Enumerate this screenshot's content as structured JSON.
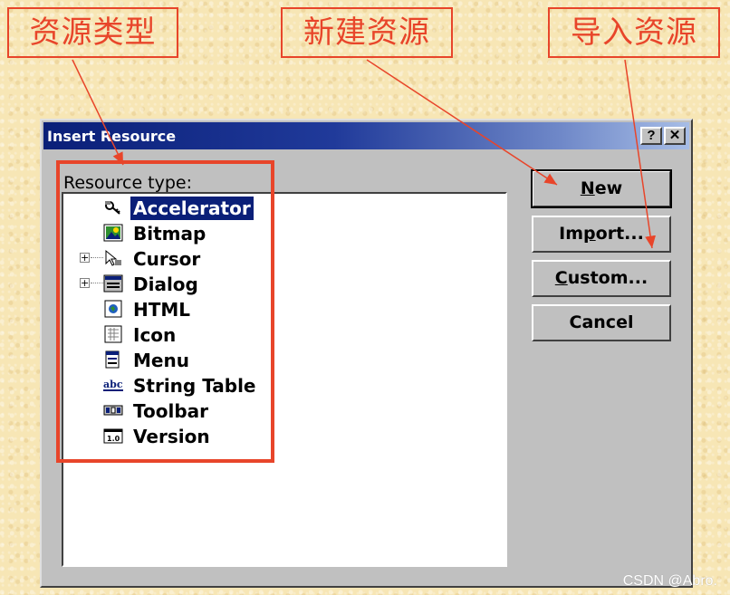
{
  "annotations": {
    "resource_type": "资源类型",
    "new_resource": "新建资源",
    "import_resource": "导入资源"
  },
  "dialog": {
    "title": "Insert Resource",
    "help_glyph": "?",
    "close_glyph": "✕",
    "resource_type_label": "Resource type:",
    "items": [
      {
        "label": "Accelerator",
        "icon": "accelerator-icon",
        "expandable": false,
        "selected": true
      },
      {
        "label": "Bitmap",
        "icon": "bitmap-icon",
        "expandable": false
      },
      {
        "label": "Cursor",
        "icon": "cursor-icon",
        "expandable": true
      },
      {
        "label": "Dialog",
        "icon": "dialog-icon",
        "expandable": true
      },
      {
        "label": "HTML",
        "icon": "html-icon",
        "expandable": false
      },
      {
        "label": "Icon",
        "icon": "icon-resource-icon",
        "expandable": false
      },
      {
        "label": "Menu",
        "icon": "menu-icon",
        "expandable": false
      },
      {
        "label": "String Table",
        "icon": "string-table-icon",
        "expandable": false
      },
      {
        "label": "Toolbar",
        "icon": "toolbar-icon",
        "expandable": false
      },
      {
        "label": "Version",
        "icon": "version-icon",
        "expandable": false
      }
    ],
    "buttons": {
      "new_key": "N",
      "new_rest": "ew",
      "import_pre": "Im",
      "import_key": "p",
      "import_rest": "ort...",
      "custom_key": "C",
      "custom_rest": "ustom...",
      "cancel": "Cancel"
    }
  },
  "watermark": "CSDN @Abro.",
  "colors": {
    "accent": "#e8452a",
    "titlebar": "#0a1f78",
    "dialog_face": "#c0c0c0"
  }
}
